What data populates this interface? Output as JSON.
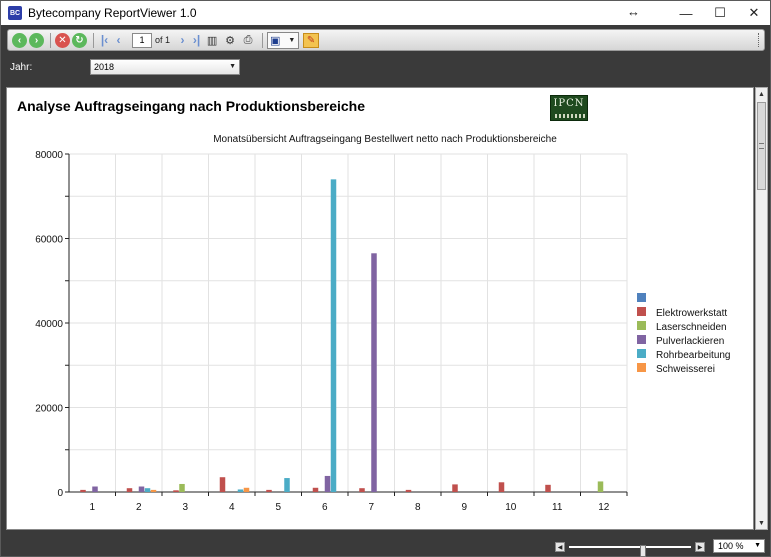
{
  "window": {
    "title": "Bytecompany ReportViewer 1.0",
    "app_icon_text": "BC",
    "controls": {
      "minimize": "—",
      "maximize": "☐",
      "close": "✕",
      "resize": "↔"
    }
  },
  "toolbar": {
    "page_current": "1",
    "page_of": "of 1"
  },
  "parameters": {
    "year_label": "Jahr:",
    "year_value": "2018"
  },
  "report": {
    "title": "Analyse Auftragseingang nach Produktionsbereiche",
    "logo_text": "IPCN"
  },
  "chart_data": {
    "type": "bar",
    "title": "Monatsübersicht Auftragseingang Bestellwert netto nach Produktionsbereiche",
    "xlabel": "",
    "ylabel": "",
    "ylim": [
      0,
      80000
    ],
    "yticks": [
      0,
      20000,
      40000,
      60000,
      80000
    ],
    "grid": true,
    "legend": "right",
    "categories": [
      "1",
      "2",
      "3",
      "4",
      "5",
      "6",
      "7",
      "8",
      "9",
      "10",
      "11",
      "12"
    ],
    "series": [
      {
        "name": "",
        "color": "#4f81bd",
        "values": [
          0,
          0,
          0,
          0,
          0,
          0,
          0,
          0,
          0,
          0,
          0,
          0
        ]
      },
      {
        "name": "Elektrowerkstatt",
        "color": "#c0504d",
        "values": [
          500,
          900,
          400,
          3500,
          500,
          1000,
          900,
          500,
          1800,
          2300,
          1700,
          0
        ]
      },
      {
        "name": "Laserschneiden",
        "color": "#9bbb59",
        "values": [
          0,
          0,
          1900,
          0,
          0,
          0,
          0,
          0,
          0,
          0,
          0,
          2500
        ]
      },
      {
        "name": "Pulverlackieren",
        "color": "#8064a2",
        "values": [
          1300,
          1300,
          0,
          0,
          0,
          3800,
          56500,
          0,
          0,
          0,
          0,
          0
        ]
      },
      {
        "name": "Rohrbearbeitung",
        "color": "#4bacc6",
        "values": [
          0,
          900,
          0,
          600,
          3300,
          74000,
          0,
          0,
          0,
          0,
          0,
          0
        ]
      },
      {
        "name": "Schweisserei",
        "color": "#f79646",
        "values": [
          0,
          500,
          0,
          1000,
          0,
          0,
          0,
          0,
          0,
          0,
          0,
          0
        ]
      }
    ]
  },
  "statusbar": {
    "zoom_level": "100 %"
  }
}
